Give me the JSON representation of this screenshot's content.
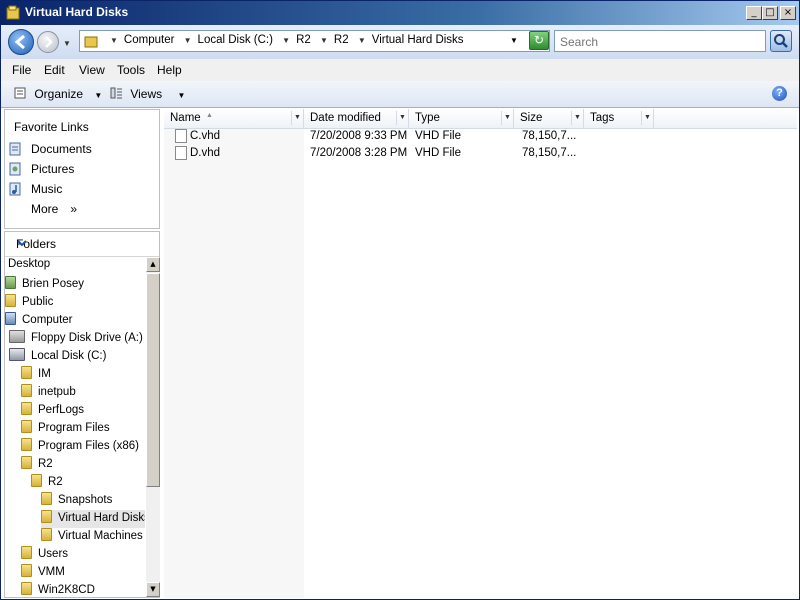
{
  "window": {
    "title": "Virtual Hard Disks"
  },
  "breadcrumb": [
    "Computer",
    "Local Disk (C:)",
    "R2",
    "R2",
    "Virtual Hard Disks"
  ],
  "search": {
    "placeholder": "Search"
  },
  "menu": [
    "File",
    "Edit",
    "View",
    "Tools",
    "Help"
  ],
  "toolbar": {
    "organize": "Organize",
    "views": "Views"
  },
  "favorites": {
    "header": "Favorite Links",
    "items": [
      "Documents",
      "Pictures",
      "Music"
    ],
    "more": "More"
  },
  "folders": {
    "header": "Folders",
    "tree": [
      {
        "label": "Desktop",
        "icon": "desktop-icon"
      },
      {
        "label": "Brien Posey",
        "icon": "user-folder-icon"
      },
      {
        "label": "Public",
        "icon": "folder-icon"
      },
      {
        "label": "Computer",
        "icon": "computer-icon"
      },
      {
        "label": "Floppy Disk Drive (A:)",
        "icon": "floppy-icon"
      },
      {
        "label": "Local Disk (C:)",
        "icon": "drive-icon"
      },
      {
        "label": "IM",
        "icon": "folder-icon"
      },
      {
        "label": "inetpub",
        "icon": "folder-icon"
      },
      {
        "label": "PerfLogs",
        "icon": "folder-icon"
      },
      {
        "label": "Program Files",
        "icon": "folder-icon"
      },
      {
        "label": "Program Files (x86)",
        "icon": "folder-icon"
      },
      {
        "label": "R2",
        "icon": "folder-icon"
      },
      {
        "label": "R2",
        "icon": "folder-icon"
      },
      {
        "label": "Snapshots",
        "icon": "folder-icon"
      },
      {
        "label": "Virtual Hard Disks",
        "icon": "folder-icon",
        "selected": true
      },
      {
        "label": "Virtual Machines",
        "icon": "folder-icon"
      },
      {
        "label": "Users",
        "icon": "folder-icon"
      },
      {
        "label": "VMM",
        "icon": "folder-icon"
      },
      {
        "label": "Win2K8CD",
        "icon": "folder-icon"
      }
    ]
  },
  "columns": [
    "Name",
    "Date modified",
    "Type",
    "Size",
    "Tags"
  ],
  "files": [
    {
      "name": "C.vhd",
      "date": "7/20/2008 9:33 PM",
      "type": "VHD File",
      "size": "78,150,7..."
    },
    {
      "name": "D.vhd",
      "date": "7/20/2008 3:28 PM",
      "type": "VHD File",
      "size": "78,150,7..."
    }
  ]
}
